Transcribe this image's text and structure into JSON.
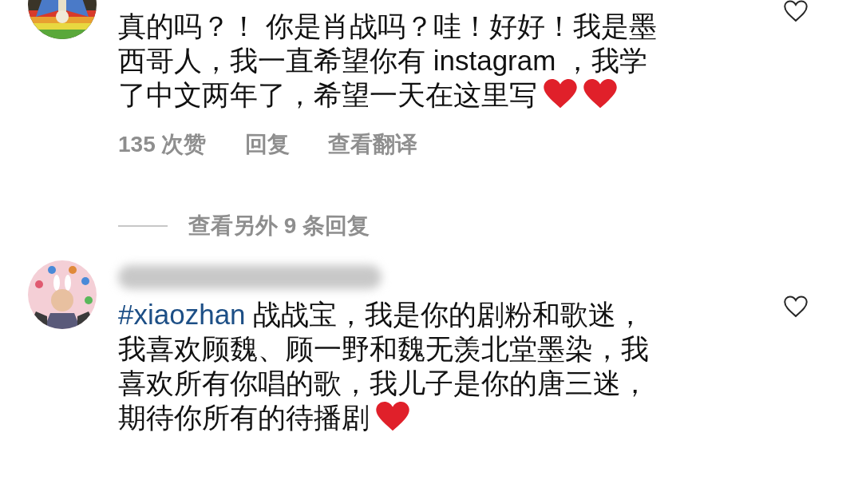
{
  "comments": [
    {
      "avatar": {
        "kind": "picture"
      },
      "lines": [
        "真的吗？！ 你是肖战吗？哇！好好！我是墨",
        "西哥人，我一直希望你有 instagram ，我学",
        "了中文两年了，希望一天在这里写"
      ],
      "emoji": [
        {
          "kind": "heart"
        },
        {
          "kind": "heart"
        }
      ],
      "liked": false,
      "meta": {
        "likes": "135 次赞",
        "reply": "回复",
        "translate": "查看翻译"
      },
      "more_replies": "查看另外 9 条回复"
    },
    {
      "avatar": {
        "kind": "picture"
      },
      "username": {
        "kind": "redacted"
      },
      "hashtag": "#xiaozhan",
      "lines": [
        " 战战宝，我是你的剧粉和歌迷，",
        "我喜欢顾魏、顾一野和魏无羡北堂墨染，我",
        "喜欢所有你唱的歌，我儿子是你的唐三迷，",
        "期待你所有的待播剧"
      ],
      "emoji": [
        {
          "kind": "heart"
        }
      ],
      "liked": false
    }
  ]
}
